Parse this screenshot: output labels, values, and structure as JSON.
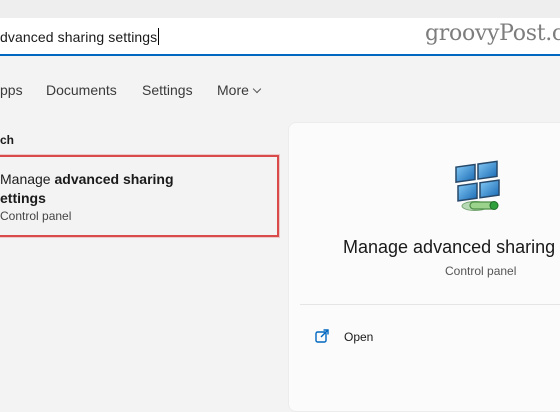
{
  "search": {
    "query_visible": "dvanced sharing settings"
  },
  "watermark": "groovyPost.c",
  "filter_tabs": {
    "apps": "pps",
    "documents": "Documents",
    "settings": "Settings",
    "more": "More"
  },
  "results": {
    "section_label": "ch",
    "best_match": {
      "title_prefix": "Manage ",
      "title_bold_line1": "advanced sharing",
      "title_bold_line2": "ettings",
      "subtitle": "Control panel"
    }
  },
  "preview": {
    "app_icon": "network-computers-icon",
    "title": "Manage advanced sharing s",
    "subtitle": "Control panel",
    "actions": [
      {
        "icon": "open-external-icon",
        "label": "Open"
      }
    ]
  },
  "colors": {
    "accent": "#0067c0",
    "highlight": "#d94a4a",
    "background": "#f3f3f3"
  }
}
